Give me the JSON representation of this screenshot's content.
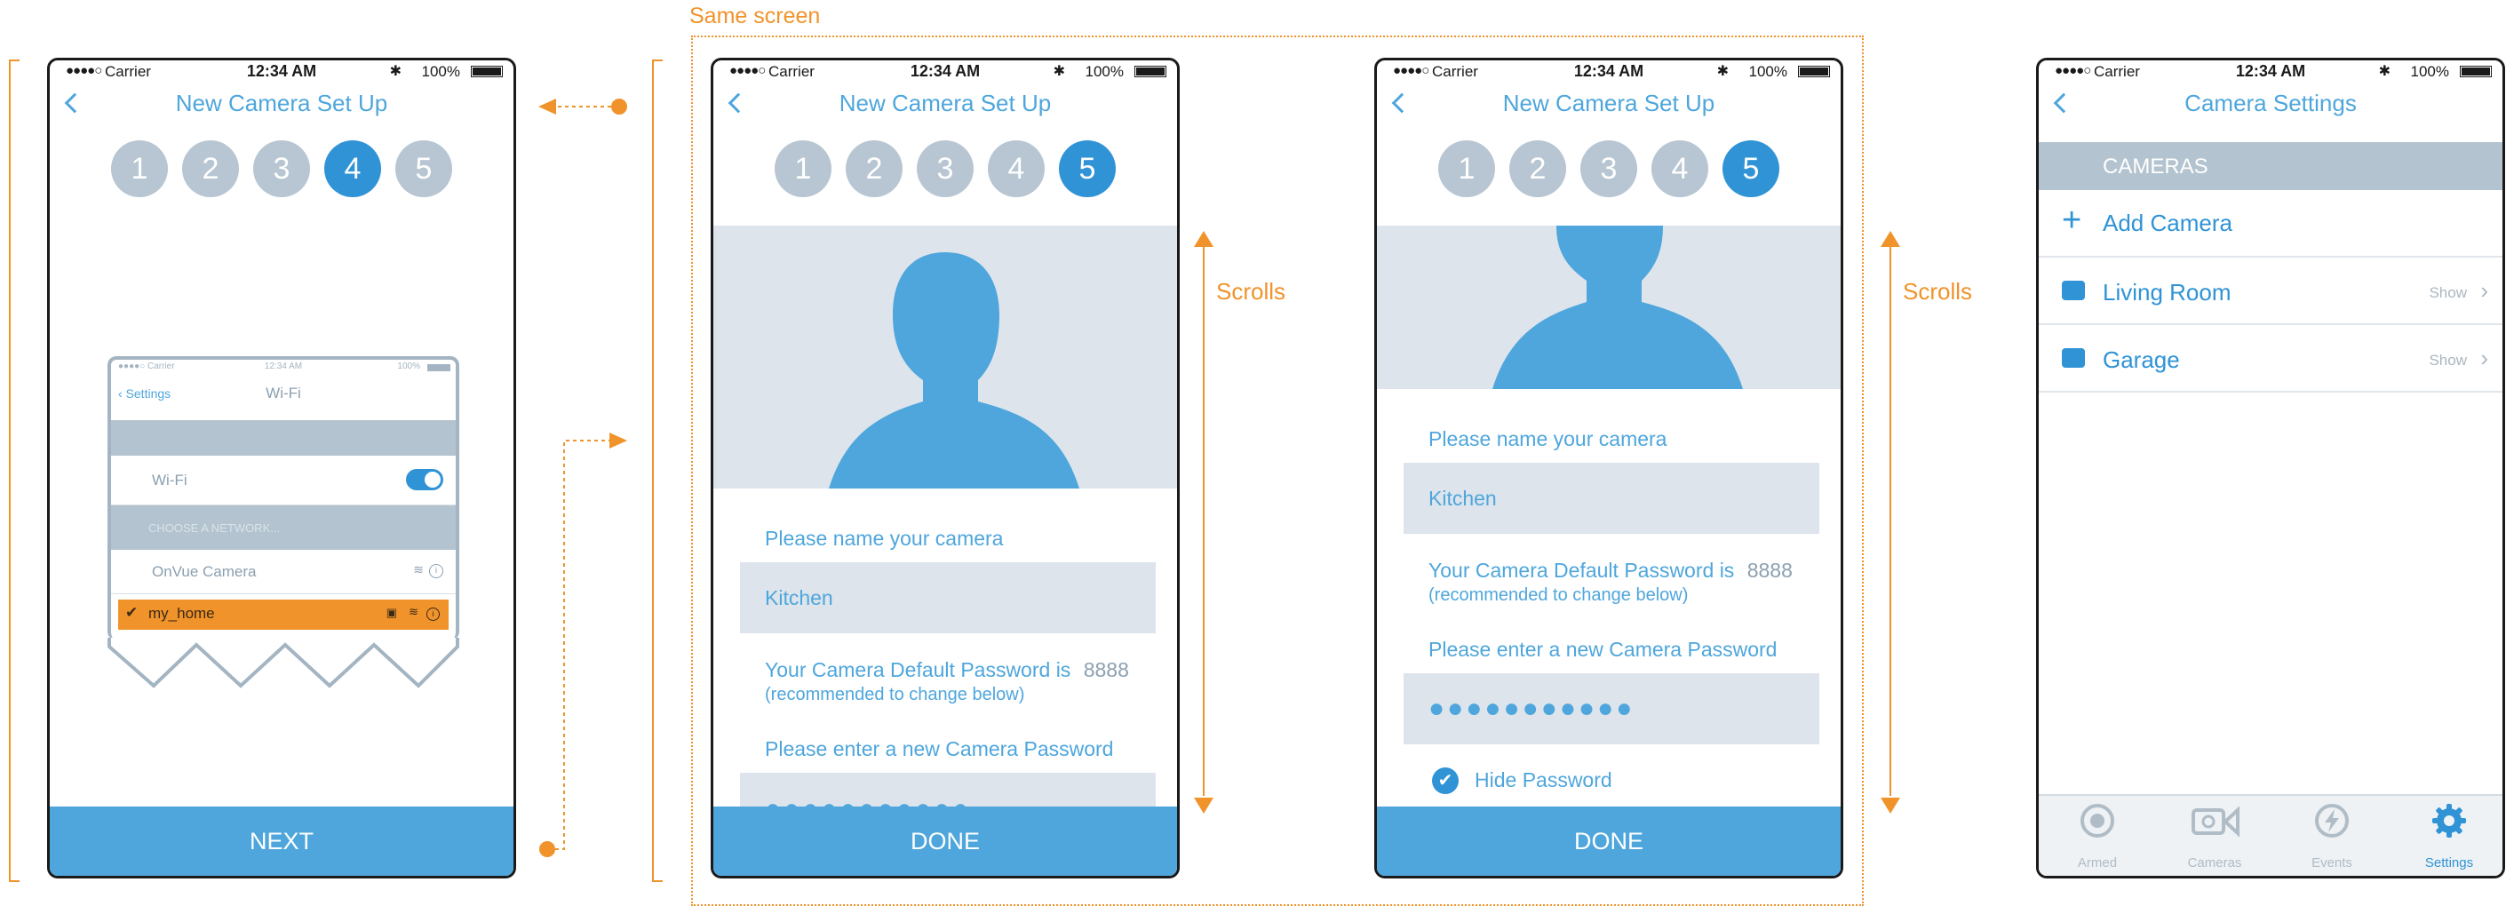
{
  "annotations": {
    "same_screen": "Same screen",
    "scrolls_1": "Scrolls",
    "scrolls_2": "Scrolls"
  },
  "status_bar": {
    "signal": "●●●●○",
    "carrier": "Carrier",
    "time": "12:34 AM",
    "battery": "100%"
  },
  "screen1": {
    "title": "New Camera Set Up",
    "steps": [
      "1",
      "2",
      "3",
      "4",
      "5"
    ],
    "active_step": "4",
    "button": "NEXT",
    "mini_wifi": {
      "status_carrier": "Carrier",
      "status_time": "12:34 AM",
      "status_batt": "100%",
      "back": "Settings",
      "title": "Wi-Fi",
      "wifi_label": "Wi-Fi",
      "wifi_on": true,
      "section": "CHOOSE A NETWORK...",
      "networks": [
        "OnVue Camera",
        "my_home"
      ]
    }
  },
  "screen2": {
    "title": "New Camera Set Up",
    "steps": [
      "1",
      "2",
      "3",
      "4",
      "5"
    ],
    "active_step": "5",
    "name_label": "Please name your camera",
    "name_value": "Kitchen",
    "default_pwd_label": "Your Camera Default Password is",
    "default_pwd": "8888",
    "recommend": "(recommended to change below)",
    "new_pwd_label": "Please enter a new Camera Password",
    "pwd_dots": "●●●●●●●●●●●",
    "button": "DONE"
  },
  "screen3": {
    "title": "New Camera Set Up",
    "steps": [
      "1",
      "2",
      "3",
      "4",
      "5"
    ],
    "active_step": "5",
    "name_label": "Please name your camera",
    "name_value": "Kitchen",
    "default_pwd_label": "Your Camera Default Password is",
    "default_pwd": "8888",
    "recommend": "(recommended to change below)",
    "new_pwd_label": "Please enter a new Camera Password",
    "pwd_dots": "●●●●●●●●●●●",
    "hide_label": "Hide Password",
    "button": "DONE"
  },
  "screen4": {
    "title": "Camera Settings",
    "section": "CAMERAS",
    "add_camera": "Add Camera",
    "cameras": [
      {
        "name": "Living Room",
        "action": "Show"
      },
      {
        "name": "Garage",
        "action": "Show"
      }
    ],
    "tabs": [
      {
        "label": "Armed",
        "icon": "armed-icon"
      },
      {
        "label": "Cameras",
        "icon": "camera-icon"
      },
      {
        "label": "Events",
        "icon": "events-icon"
      },
      {
        "label": "Settings",
        "icon": "gear-icon"
      }
    ],
    "active_tab": "Settings"
  },
  "colors": {
    "accent": "#4ea6dc",
    "active_step": "#2f93d6",
    "annotation": "#f0932b",
    "field_bg": "#dde4ec",
    "step_inactive": "#b7c6d2"
  }
}
